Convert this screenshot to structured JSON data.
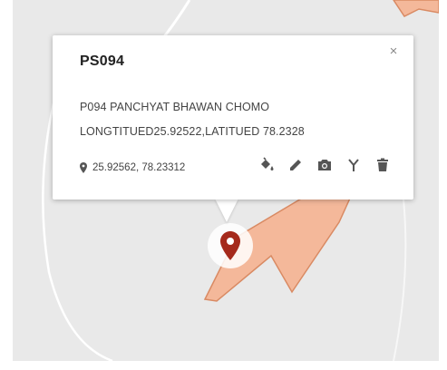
{
  "popup": {
    "title": "PS094",
    "close_glyph": "×",
    "description_line1": "P094 PANCHYAT BHAWAN CHOMO",
    "description_line2": "LONGTITUED25.92522,LATITUED 78.2328",
    "coordinates": "25.92562, 78.23312",
    "location_icon": "location-pin-icon"
  },
  "toolbar": {
    "items": [
      {
        "name": "fill-color-icon"
      },
      {
        "name": "edit-pencil-icon"
      },
      {
        "name": "camera-icon"
      },
      {
        "name": "split-icon"
      },
      {
        "name": "delete-trash-icon"
      }
    ]
  },
  "map": {
    "marker_icon": "map-marker-icon",
    "marker_color": "#a52a1c",
    "polygon_fill": "#f4b89a",
    "polygon_stroke": "#d98a63",
    "background_color": "#e9e9e9"
  }
}
